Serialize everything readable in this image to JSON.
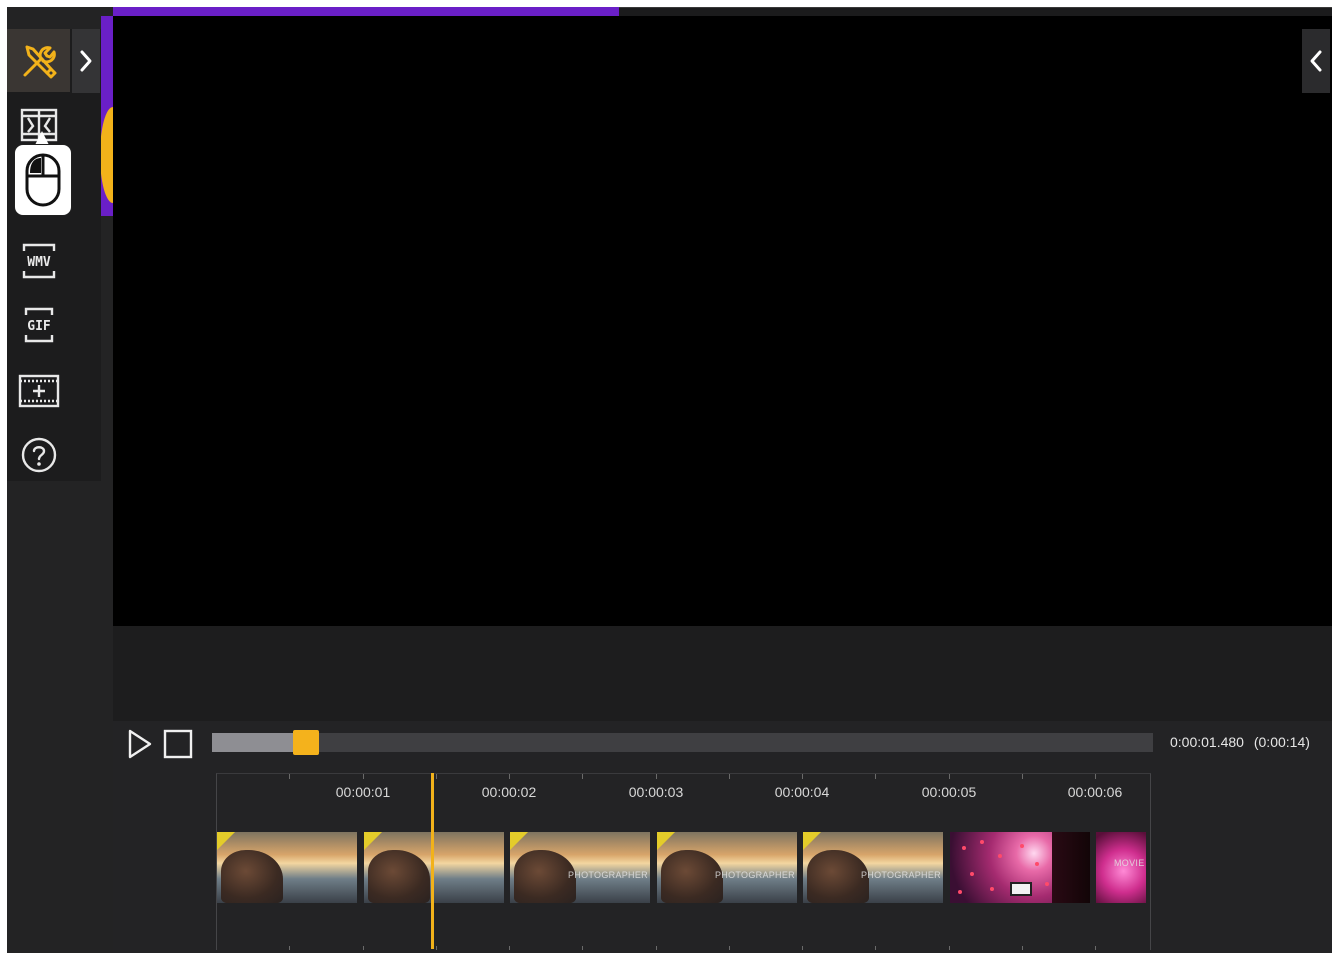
{
  "window": {
    "accent_color": "#6a1fc7",
    "highlight_color": "#f4b21c"
  },
  "toolbar": {
    "items": [
      {
        "name": "tools-icon",
        "label": "",
        "active": true
      },
      {
        "name": "trim-film-icon",
        "label": ""
      },
      {
        "name": "wmv-export-icon",
        "label": "WMV"
      },
      {
        "name": "gif-export-icon",
        "label": "GIF"
      },
      {
        "name": "add-clip-icon",
        "label": ""
      },
      {
        "name": "help-icon",
        "label": ""
      }
    ],
    "tooltip_icon": "mouse-icon",
    "expand_icon": "chevron-right-icon"
  },
  "preview": {
    "collapse_icon": "chevron-left-icon"
  },
  "playback": {
    "play_icon": "play-icon",
    "stop_icon": "stop-icon",
    "progress_fraction": 0.1,
    "current_time": "0:00:01.480",
    "total_time": "(0:00:14)"
  },
  "timeline": {
    "tick_labels": [
      "00:00:01",
      "00:00:02",
      "00:00:03",
      "00:00:04",
      "00:00:05",
      "00:00:06"
    ],
    "playhead_time": "00:00:01.480",
    "clips": [
      {
        "kind": "sunset",
        "caption": ""
      },
      {
        "kind": "sunset",
        "caption": ""
      },
      {
        "kind": "sunset",
        "caption": "PHOTOGRAPHER"
      },
      {
        "kind": "sunset",
        "caption": "PHOTOGRAPHER"
      },
      {
        "kind": "sunset",
        "caption": "PHOTOGRAPHER"
      },
      {
        "kind": "concert",
        "caption": ""
      },
      {
        "kind": "movie",
        "caption": "MOVIE"
      }
    ]
  }
}
